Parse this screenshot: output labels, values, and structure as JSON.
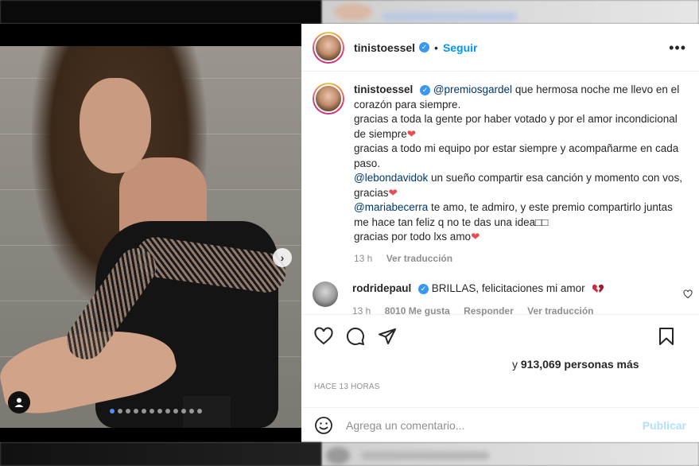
{
  "post": {
    "author": "tinistoessel",
    "follow_label": "Seguir",
    "separator": "•",
    "more_icon": "more-horizontal-icon",
    "caption": {
      "author": "tinistoessel",
      "mention_1": "@premiosgardel",
      "text_1": " que hermosa noche me llevo en el corazón para siempre.",
      "text_2": "gracias a toda la gente por haber votado y por el amor incondicional de siempre",
      "text_3": "gracias a todo mi equipo por estar siempre y acompañarme en cada paso.",
      "mention_2": "@lebondavidok",
      "text_4": " un sueño compartir esa canción y momento con vos, gracias",
      "mention_3": "@mariabecerra",
      "text_5": " te amo, te admiro, y este premio compartirlo juntas me hace tan feliz q no te das una idea",
      "text_5_suffix": "□□",
      "text_6": "gracias por todo lxs amo",
      "heart": "❤",
      "time": "13 h",
      "translate": "Ver traducción"
    },
    "reply": {
      "author": "rodridepaul",
      "text": "BRILLAS, felicitaciones mi amor",
      "time": "13 h",
      "likes": "8010 Me gusta",
      "reply_label": "Responder",
      "translate": "Ver traducción"
    },
    "likes_prefix": "y ",
    "likes_count": "913,069 personas más",
    "time_ago": "HACE 13 HORAS",
    "comment_placeholder": "Agrega un comentario...",
    "publish_label": "Publicar"
  },
  "carousel": {
    "total_slides": 12,
    "active_index": 0,
    "next_glyph": "›"
  },
  "colors": {
    "accent": "#0095f6",
    "heart": "#ed4956",
    "verified": "#3897f0",
    "mention": "#00376b"
  }
}
